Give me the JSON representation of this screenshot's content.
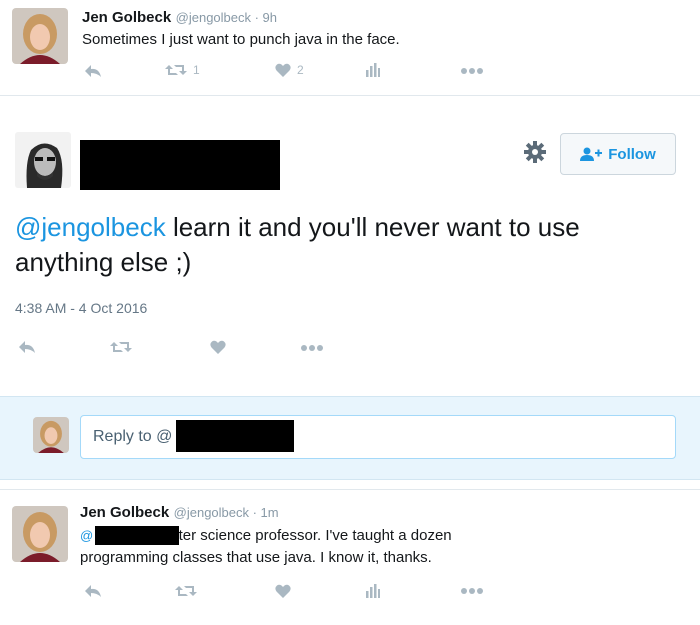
{
  "tweet_top": {
    "name": "Jen Golbeck",
    "handle": "@jengolbeck · 9h",
    "text": "Sometimes I just want to punch java in the face.",
    "retweet_count": "1",
    "like_count": "2"
  },
  "main_tweet": {
    "follow_label": "Follow",
    "text_mention": "@jengolbeck",
    "text_rest": " learn it and you'll never want to use anything else ;)",
    "timestamp": "4:38 AM - 4 Oct 2016"
  },
  "reply": {
    "placeholder": "Reply to @"
  },
  "tweet_bottom": {
    "name": "Jen Golbeck",
    "handle": "@jengolbeck · 1m",
    "mention_prefix": "@",
    "text_line1": "I'm a computer science professor. I've taught a dozen",
    "text_line2": "programming classes that use java. I know it, thanks."
  },
  "colors": {
    "accent": "#1b95e0",
    "action_gray": "#aab8c2",
    "reply_bg": "#e8f5fd"
  },
  "icons": {
    "reply": "reply-icon",
    "retweet": "retweet-icon",
    "like": "heart-icon",
    "analytics": "analytics-icon",
    "more": "more-dots-icon",
    "settings": "gear-icon",
    "follow": "add-user-icon"
  }
}
